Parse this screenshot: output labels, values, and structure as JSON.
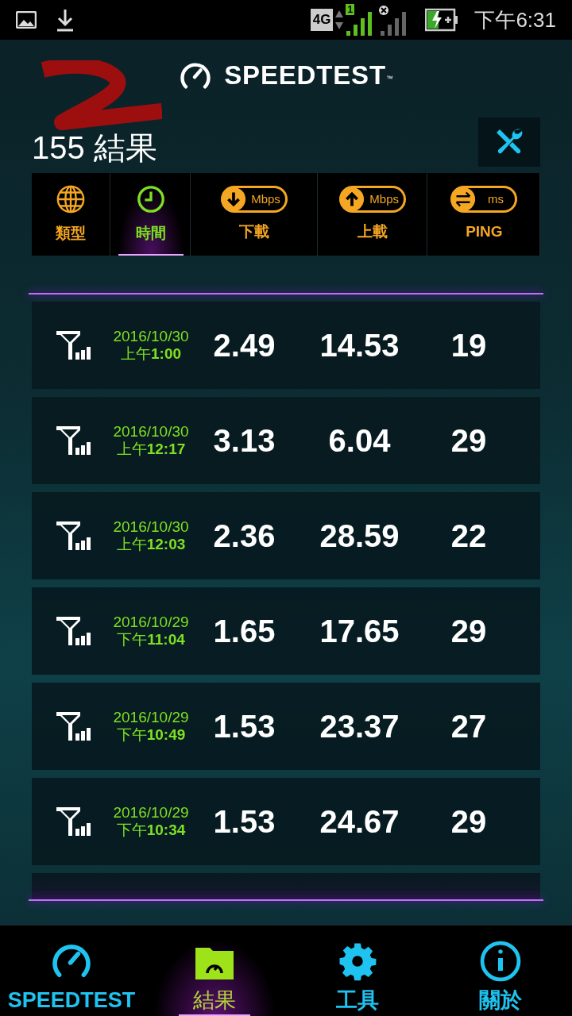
{
  "status_bar": {
    "network_type": "4G",
    "sim_label": "1",
    "time": "下午6:31"
  },
  "header": {
    "logo": "SPEEDTEST",
    "trademark": "™"
  },
  "results": {
    "count": "155",
    "label": "結果"
  },
  "sort_columns": [
    {
      "kind": "globe",
      "label": "類型",
      "selected": false
    },
    {
      "kind": "clock",
      "label": "時間",
      "selected": true
    },
    {
      "kind": "download",
      "label": "下載",
      "unit": "Mbps",
      "selected": false
    },
    {
      "kind": "upload",
      "label": "上載",
      "unit": "Mbps",
      "selected": false
    },
    {
      "kind": "ping",
      "label": "PING",
      "unit": "ms",
      "selected": false
    }
  ],
  "rows": [
    {
      "date": "2016/10/30",
      "period": "上午",
      "time": "1:00",
      "download": "2.49",
      "upload": "14.53",
      "ping": "19"
    },
    {
      "date": "2016/10/30",
      "period": "上午",
      "time": "12:17",
      "download": "3.13",
      "upload": "6.04",
      "ping": "29"
    },
    {
      "date": "2016/10/30",
      "period": "上午",
      "time": "12:03",
      "download": "2.36",
      "upload": "28.59",
      "ping": "22"
    },
    {
      "date": "2016/10/29",
      "period": "下午",
      "time": "11:04",
      "download": "1.65",
      "upload": "17.65",
      "ping": "29"
    },
    {
      "date": "2016/10/29",
      "period": "下午",
      "time": "10:49",
      "download": "1.53",
      "upload": "23.37",
      "ping": "27"
    },
    {
      "date": "2016/10/29",
      "period": "下午",
      "time": "10:34",
      "download": "1.53",
      "upload": "24.67",
      "ping": "29"
    }
  ],
  "bottom_nav": [
    {
      "kind": "speedtest",
      "label": "SPEEDTEST",
      "selected": false
    },
    {
      "kind": "results",
      "label": "結果",
      "selected": true
    },
    {
      "kind": "tools",
      "label": "工具",
      "selected": false
    },
    {
      "kind": "about",
      "label": "關於",
      "selected": false
    }
  ]
}
